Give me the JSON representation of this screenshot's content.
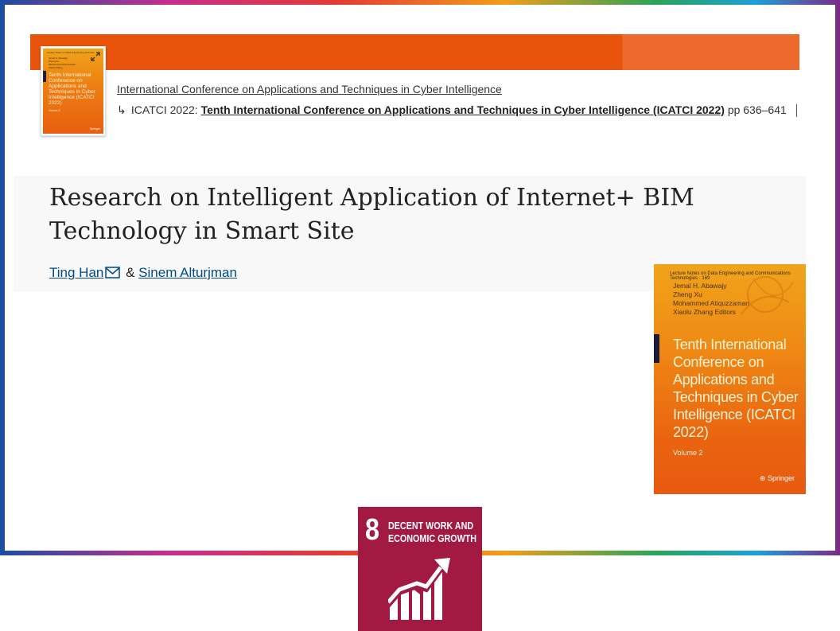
{
  "header": {
    "series_link": "International Conference on Applications and Techniques in Cyber Intelligence",
    "conf_prefix": "ICATCI 2022:",
    "conf_title": "Tenth International Conference on Applications and Techniques in Cyber Intelligence (ICATCI 2022)",
    "pages": "pp 636–641",
    "arrow": "↳"
  },
  "article": {
    "title": "Research on Intelligent Application of Internet+ BIM Technology in Smart Site",
    "authors": [
      "Ting Han",
      "Sinem Alturjman"
    ],
    "author_separator": "&"
  },
  "book_cover": {
    "series": "Lecture Notes on Data Engineering and Communications Technologies · 169",
    "editors": [
      "Jemal H. Abawajy",
      "Zheng Xu",
      "Mohammed Atiquzzaman",
      "Xiaolu Zhang",
      "Editors"
    ],
    "title": "Tenth International Conference on Applications and Techniques in Cyber Intelligence (ICATCI 2022)",
    "volume": "Volume 2",
    "publisher": "Springer"
  },
  "sdg": {
    "number": "8",
    "label_line1": "DECENT WORK AND",
    "label_line2": "ECONOMIC GROWTH"
  },
  "colors": {
    "orange_bar": "#e8540b",
    "link_blue": "#004b83",
    "sdg_red": "#a21942"
  }
}
